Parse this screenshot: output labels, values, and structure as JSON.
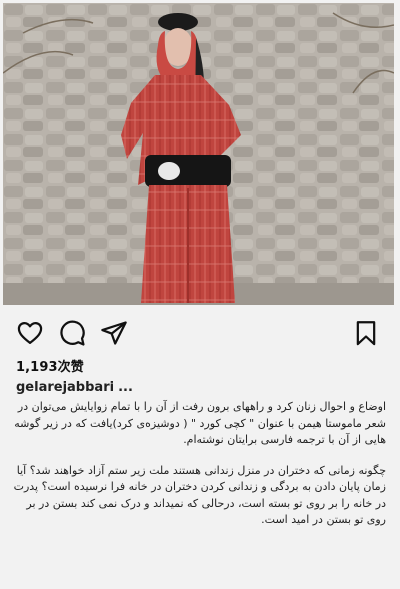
{
  "post": {
    "image_alt": "",
    "likes_count": "1,193",
    "likes_suffix": "次赞",
    "username": "gelarejabbari",
    "more": "...",
    "caption_paragraphs": [
      "اوضاع و احوال زنان کرد و راههای برون رفت از آن را با تمام زوایایش می‌توان در شعر ماموستا هیمن با عنوان \" کچی کورد \" ( دوشیزه‌ی کرد)یافت که در زیر گوشه هایی از آن با ترجمه فارسی برایتان نوشته‌ام.",
      "چگونه زمانی که دختران در منزل زندانی هستند ملت زیر ستم آزاد خواهند شد؟ آیا زمان پایان دادن به بردگی و زندانی کردن دختران در خانه فرا نرسیده است؟ پدرت در خانه را بر روی تو بسته است، درحالی که نمیداند و درک نمی کند بستن در بر روی تو بستن در امید است."
    ]
  },
  "icons": {
    "like": "heart-icon",
    "comment": "comment-bubble-icon",
    "share": "paper-plane-icon",
    "save": "bookmark-icon"
  },
  "colors": {
    "background": "#f2f2f2",
    "dress": "#c0453f",
    "wall": "#b8b2aa"
  }
}
